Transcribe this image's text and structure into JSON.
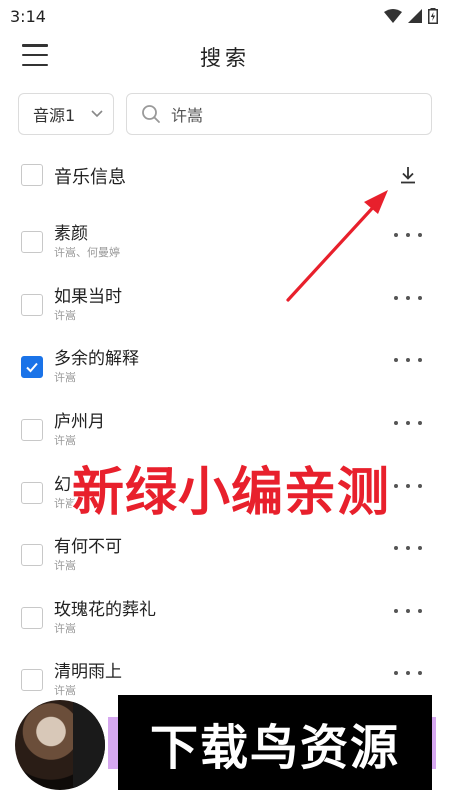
{
  "status_bar": {
    "time": "3:14"
  },
  "header": {
    "title": "搜索"
  },
  "search": {
    "source": "音源1",
    "query": "许嵩"
  },
  "list_header": {
    "label": "音乐信息"
  },
  "songs": [
    {
      "title": "素颜",
      "artist": "许嵩、何曼婷",
      "checked": false
    },
    {
      "title": "如果当时",
      "artist": "许嵩",
      "checked": false
    },
    {
      "title": "多余的解释",
      "artist": "许嵩",
      "checked": true
    },
    {
      "title": "庐州月",
      "artist": "许嵩",
      "checked": false
    },
    {
      "title": "幻",
      "artist": "许嵩",
      "checked": false
    },
    {
      "title": "有何不可",
      "artist": "许嵩",
      "checked": false
    },
    {
      "title": "玫瑰花的葬礼",
      "artist": "许嵩",
      "checked": false
    },
    {
      "title": "清明雨上",
      "artist": "许嵩",
      "checked": false
    }
  ],
  "overlay": {
    "caption": "新绿小编亲测",
    "watermark": "下载鸟资源"
  },
  "colors": {
    "accent": "#1a73e8",
    "annotation_red": "#e8202c",
    "player_strip": "#d6a8f0"
  }
}
